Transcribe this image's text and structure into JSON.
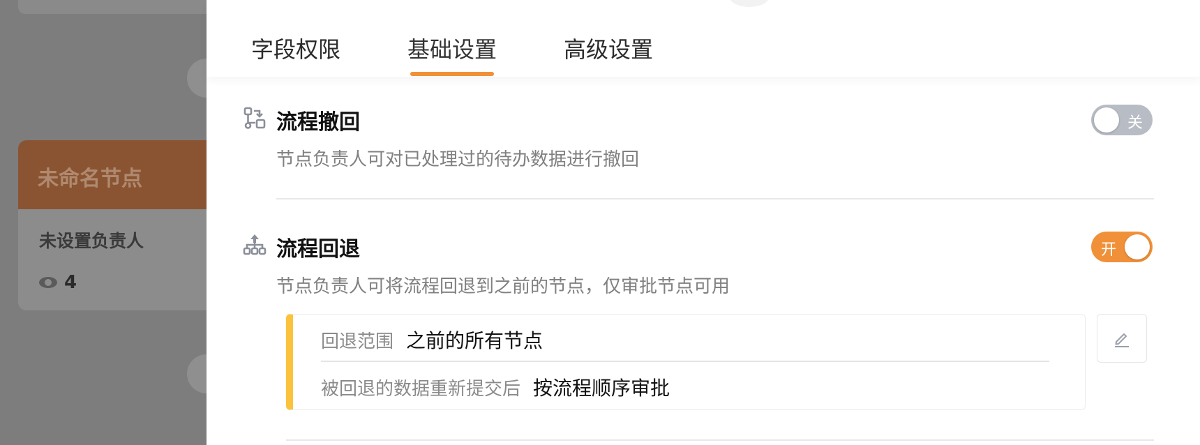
{
  "background": {
    "node_title": "未命名节点",
    "node_owner": "未设置负责人",
    "view_count": "4"
  },
  "tabs": [
    {
      "label": "字段权限",
      "active": false
    },
    {
      "label": "基础设置",
      "active": true
    },
    {
      "label": "高级设置",
      "active": false
    }
  ],
  "settings": {
    "withdraw": {
      "title": "流程撤回",
      "description": "节点负责人可对已处理过的待办数据进行撤回",
      "toggle_label": "关",
      "enabled": false,
      "icon": "flow-withdraw-icon"
    },
    "rollback": {
      "title": "流程回退",
      "description": "节点负责人可将流程回退到之前的节点，仅审批节点可用",
      "toggle_label": "开",
      "enabled": true,
      "icon": "flow-rollback-icon",
      "config": {
        "scope_label": "回退范围",
        "scope_value": "之前的所有节点",
        "resubmit_label": "被回退的数据重新提交后",
        "resubmit_value": "按流程顺序审批"
      }
    }
  },
  "colors": {
    "accent": "#f0913a",
    "toggle_off": "#b8bcc4",
    "config_bar": "#fbc33d"
  }
}
